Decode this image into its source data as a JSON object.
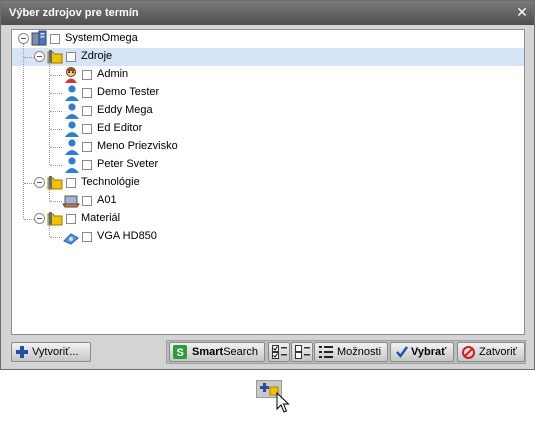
{
  "dialog": {
    "title": "Výber zdrojov pre termín",
    "close_glyph": "✕"
  },
  "tree": [
    {
      "label": "SystemOmega",
      "icon": "system-icon",
      "level": 0,
      "expanded": true,
      "selected": false
    },
    {
      "label": "Zdroje",
      "icon": "folder-icon",
      "level": 1,
      "expanded": true,
      "selected": true
    },
    {
      "label": "Admin",
      "icon": "admin-user-icon",
      "level": 2,
      "selected": false
    },
    {
      "label": "Demo Tester",
      "icon": "user-icon",
      "level": 2,
      "selected": false
    },
    {
      "label": "Eddy Mega",
      "icon": "user-icon",
      "level": 2,
      "selected": false
    },
    {
      "label": "Ed Editor",
      "icon": "user-icon",
      "level": 2,
      "selected": false
    },
    {
      "label": "Meno Priezvisko",
      "icon": "user-icon",
      "level": 2,
      "selected": false
    },
    {
      "label": "Peter Sveter",
      "icon": "user-icon",
      "level": 2,
      "selected": false
    },
    {
      "label": "Technológie",
      "icon": "folder-icon",
      "level": 1,
      "expanded": true,
      "selected": false
    },
    {
      "label": "A01",
      "icon": "laptop-icon",
      "level": 2,
      "selected": false
    },
    {
      "label": "Materiál",
      "icon": "folder-icon",
      "level": 1,
      "expanded": true,
      "selected": false
    },
    {
      "label": "VGA HD850",
      "icon": "device-icon",
      "level": 2,
      "selected": false
    }
  ],
  "buttons": {
    "create": "Vytvoriť...",
    "smartsearch_bold": "Smart",
    "smartsearch_rest": "Search",
    "options": "Možnosti",
    "select": "Vybrať",
    "close": "Zatvoriť"
  },
  "colors": {
    "titlebar": "#5c5c5c",
    "selection": "#d7e4f6",
    "folder": "#f2c200",
    "user": "#2f7fd0",
    "accent_green": "#2e9a3a",
    "cancel_red": "#d11f1f"
  }
}
